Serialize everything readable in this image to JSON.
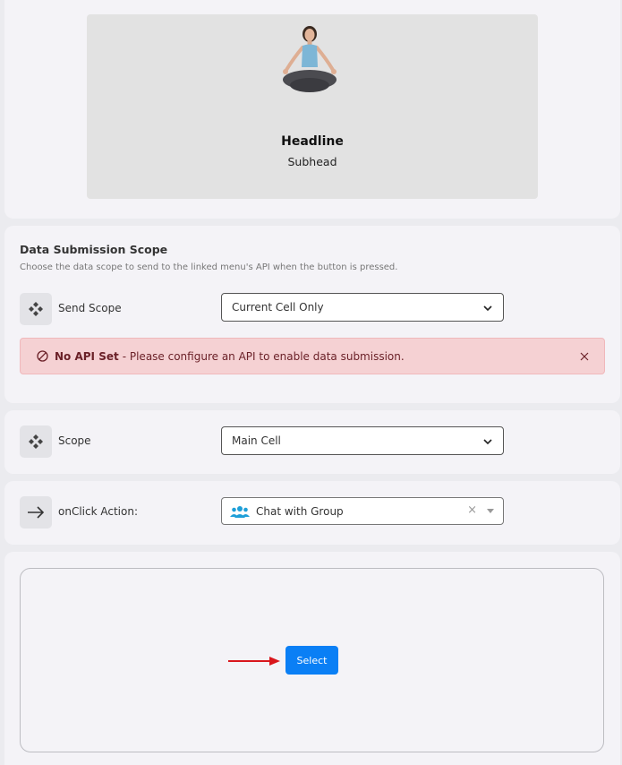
{
  "preview": {
    "headline": "Headline",
    "subhead": "Subhead",
    "image": "meditating-woman-image"
  },
  "submission": {
    "title": "Data Submission Scope",
    "description": "Choose the data scope to send to the linked menu's API when the button is pressed.",
    "send_scope_label": "Send Scope",
    "send_scope_value": "Current Cell Only",
    "alert_bold": "No API Set",
    "alert_text": "- Please configure an API to enable data submission."
  },
  "scope": {
    "label": "Scope",
    "value": "Main Cell"
  },
  "onclick": {
    "label": "onClick Action:",
    "value": "Chat with Group",
    "clear": "×"
  },
  "actions": {
    "select_label": "Select"
  },
  "colors": {
    "accent": "#0a7ff5",
    "alert_bg": "#f5d1d3",
    "annotation_arrow": "#d9161c",
    "group_icon": "#1e9fd8"
  }
}
